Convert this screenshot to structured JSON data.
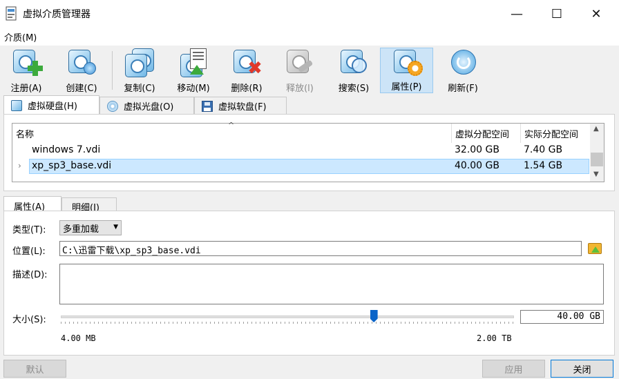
{
  "window": {
    "title": "虚拟介质管理器",
    "minimize": "—",
    "maximize": "☐",
    "close": "✕"
  },
  "menu": {
    "media": "介质(M)"
  },
  "toolbar": [
    {
      "label": "注册(A)",
      "icon": "register-icon"
    },
    {
      "label": "创建(C)",
      "icon": "create-icon"
    },
    {
      "label": "复制(C)",
      "icon": "copy-icon"
    },
    {
      "label": "移动(M)",
      "icon": "move-icon"
    },
    {
      "label": "删除(R)",
      "icon": "delete-icon"
    },
    {
      "label": "释放(l)",
      "icon": "release-icon",
      "disabled": true
    },
    {
      "label": "搜索(S)",
      "icon": "search-icon"
    },
    {
      "label": "属性(P)",
      "icon": "properties-icon",
      "active": true
    },
    {
      "label": "刷新(F)",
      "icon": "refresh-icon"
    }
  ],
  "tabs": [
    {
      "label": "虚拟硬盘(H)",
      "selected": true
    },
    {
      "label": "虚拟光盘(O)"
    },
    {
      "label": "虚拟软盘(F)"
    }
  ],
  "table": {
    "columns": [
      "名称",
      "虚拟分配空间",
      "实际分配空间"
    ],
    "rows": [
      {
        "name": "windows 7.vdi",
        "virtual": "32.00 GB",
        "actual": "7.40 GB"
      },
      {
        "name": "xp_sp3_base.vdi",
        "virtual": "40.00 GB",
        "actual": "1.54 GB",
        "selected": true
      }
    ]
  },
  "detail_tabs": [
    "属性(A)",
    "明细(I)"
  ],
  "properties": {
    "type_label": "类型(T):",
    "type_value": "多重加载",
    "location_label": "位置(L):",
    "location_value": "C:\\迅雷下载\\xp_sp3_base.vdi",
    "description_label": "描述(D):",
    "description_value": "",
    "size_label": "大小(S):",
    "size_value": "40.00 GB",
    "size_min": "4.00 MB",
    "size_max": "2.00 TB",
    "size_fraction": 0.69
  },
  "buttons": {
    "default": "默认",
    "apply": "应用",
    "close": "关闭"
  },
  "colors": {
    "selection": "#cce8ff",
    "active_tool": "#cce4f7",
    "slider_thumb": "#0a64c8"
  }
}
